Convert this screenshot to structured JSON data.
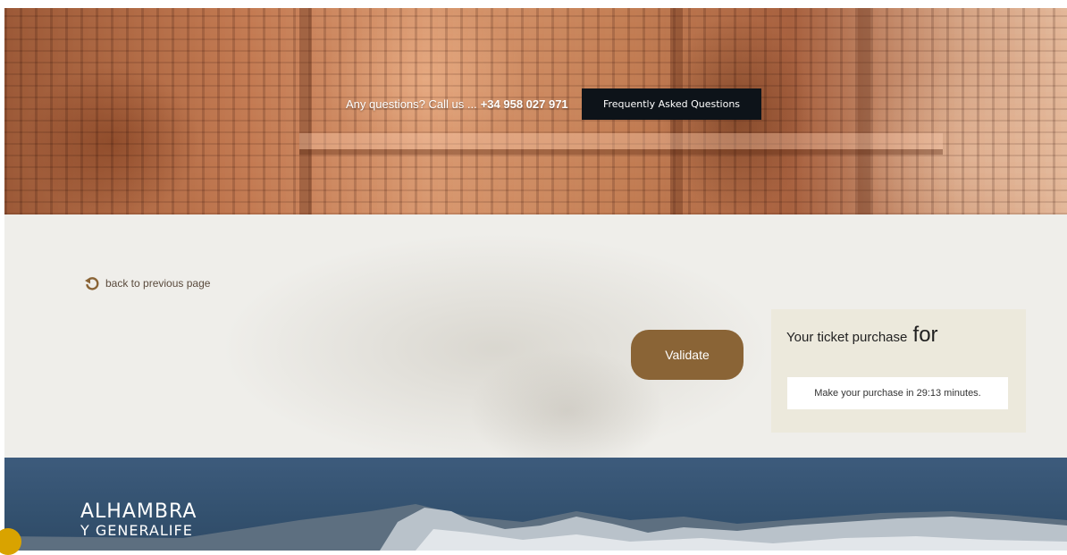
{
  "header": {
    "contact_text": "Any questions? Call us ...",
    "phone": "+34 958 027 971",
    "faq_label": "Frequently Asked Questions"
  },
  "main": {
    "back_label": "back to previous page",
    "validate_label": "Validate",
    "ticket_panel": {
      "title": "Your ticket purchase",
      "title_suffix": "for",
      "timer_text": "Make your purchase in 29:13 minutes."
    }
  },
  "footer": {
    "logo_line1": "ALHAMBRA",
    "logo_line2": "Y GENERALIFE"
  },
  "colors": {
    "accent_brown": "#8a6436",
    "dark_button": "#0d1319",
    "panel_beige": "#ece9dc",
    "footer_blue": "#3d5b7c",
    "chat_yellow": "#d9a300"
  },
  "icons": {
    "back": "back-arrow-icon",
    "chat": "chat-icon"
  }
}
